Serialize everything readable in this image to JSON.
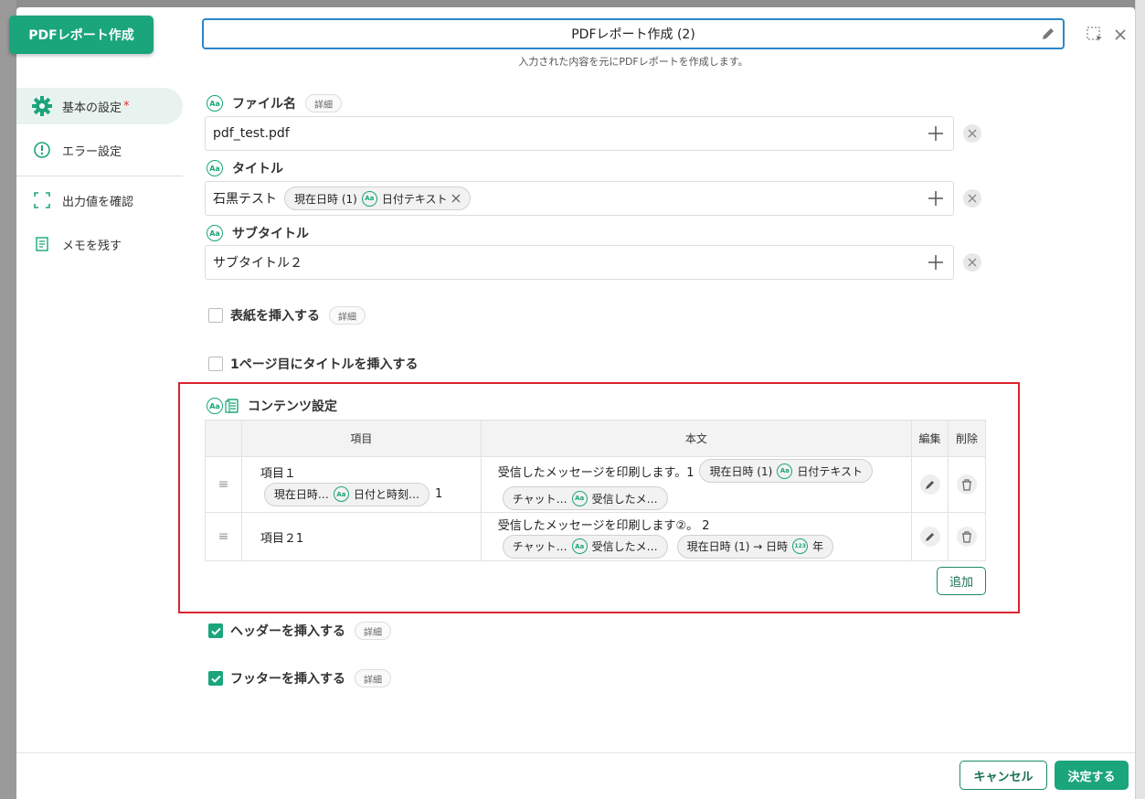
{
  "node_tag": "PDFレポート作成",
  "title": {
    "value": "PDFレポート作成 (2)",
    "caption": "入力された内容を元にPDFレポートを作成します。"
  },
  "sidebar": {
    "items": [
      {
        "label": "基本の設定",
        "required": "*"
      },
      {
        "label": "エラー設定"
      },
      {
        "label": "出力値を確認"
      },
      {
        "label": "メモを残す"
      }
    ]
  },
  "fields": {
    "filename": {
      "label": "ファイル名",
      "detail": "詳細",
      "value": "pdf_test.pdf"
    },
    "title": {
      "label": "タイトル",
      "text": "石黒テスト",
      "chip_a": "現在日時 (1)",
      "chip_b": "日付テキスト"
    },
    "subtitle": {
      "label": "サブタイトル",
      "value": "サブタイトル２"
    }
  },
  "options": {
    "cover": {
      "label": "表紙を挿入する",
      "detail": "詳細"
    },
    "first_page_title": {
      "label": "1ページ目にタイトルを挿入する"
    },
    "header": {
      "label": "ヘッダーを挿入する",
      "detail": "詳細"
    },
    "footer": {
      "label": "フッターを挿入する",
      "detail": "詳細"
    }
  },
  "contents": {
    "title": "コンテンツ設定",
    "headers": {
      "item": "項目",
      "body": "本文",
      "edit": "編集",
      "delete": "削除"
    },
    "rows": [
      {
        "item": "項目１",
        "item_chip_a": "現在日時…",
        "item_chip_b": "日付と時刻…",
        "item_tail": "1",
        "body_text": "受信したメッセージを印刷します。1",
        "body_chip1_a": "現在日時 (1)",
        "body_chip1_b": "日付テキスト",
        "body_chip2_a": "チャット…",
        "body_chip2_b": "受信したメ…"
      },
      {
        "item": "項目２1",
        "body_text": "受信したメッセージを印刷します②。 2",
        "body_chip1_a": "チャット…",
        "body_chip1_b": "受信したメ…",
        "body_chip2_a": "現在日時 (1) → 日時",
        "body_chip2_b": "年"
      }
    ],
    "add": "追加"
  },
  "footer": {
    "cancel": "キャンセル",
    "ok": "決定する"
  },
  "colors": {
    "accent": "#1aa57a",
    "highlight": "#d9242e",
    "focus": "#2a86c9"
  },
  "icons": {
    "text_type": "Aa",
    "number_type": "123"
  }
}
